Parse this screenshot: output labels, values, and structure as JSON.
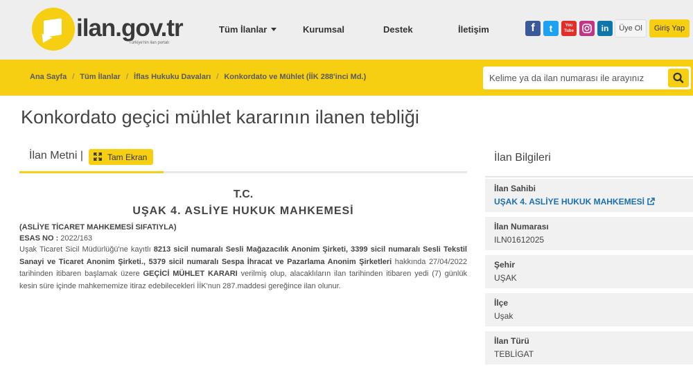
{
  "logo": {
    "text": "ilan.gov.tr",
    "tagline": "Türkiye'nin ilan portalı"
  },
  "nav": {
    "items": [
      {
        "label": "Tüm İlanlar"
      },
      {
        "label": "Kurumsal"
      },
      {
        "label": "Destek"
      },
      {
        "label": "İletişim"
      }
    ]
  },
  "social": {
    "facebook": "f",
    "twitter": "t",
    "youtube": "You Tube",
    "instagram": "ig",
    "linkedin": "in"
  },
  "auth": {
    "register_label": "Üye Ol",
    "login_label": "Giriş Yap"
  },
  "breadcrumb": {
    "items": [
      "Ana Sayfa",
      "Tüm İlanlar",
      "İflas Hukuku Davaları",
      "Konkordato ve Mühlet (İİK 288'inci Md.)"
    ]
  },
  "search": {
    "placeholder": "Kelime ya da ilan numarası ile arayınız"
  },
  "page": {
    "title": "Konkordato geçici mühlet kararının ilanen tebliği"
  },
  "tabs": {
    "active_label": "İlan Metni |",
    "fullscreen_label": "Tam Ekran"
  },
  "document": {
    "heading1": "T.C.",
    "heading2": "UŞAK 4. ASLİYE HUKUK MAHKEMESİ",
    "subheading": "(ASLİYE TİCARET MAHKEMESİ SIFATIYLA)",
    "esas_label": "ESAS NO :",
    "esas_value": " 2022/163",
    "body": [
      {
        "t": "Uşak Ticaret Sicil Müdürlüğü'ne kayıtlı ",
        "b": false
      },
      {
        "t": "8213 sicil numaralı Sesli Mağazacılık Anonim Şirketi, 3399 sicil numaralı Sesli Tekstil Sanayi ve Ticaret Anonim Şirketi., 5379 sicil numaralı Sespa İhracat ve Pazarlama Anonim Şirketleri",
        "b": true
      },
      {
        "t": " hakkında 27/04/2022 tarihinden itibaren başlamak üzere ",
        "b": false
      },
      {
        "t": "GEÇİCİ MÜHLET KARARI",
        "b": true
      },
      {
        "t": " verilmiş olup, alacaklıların ilan tarihinden itibaren yedi (7) günlük kesin süre içinde mahkememize itiraz edebilecekleri İİK'nun 287.maddesi gereğince ilan olunur.",
        "b": false
      }
    ]
  },
  "info_panel": {
    "title": "İlan Bilgileri",
    "fields": [
      {
        "label": "İlan Sahibi",
        "value": "UŞAK 4. ASLİYE HUKUK MAHKEMESİ",
        "link": true
      },
      {
        "label": "İlan Numarası",
        "value": "ILN01612025",
        "link": false
      },
      {
        "label": "Şehir",
        "value": "UŞAK",
        "link": false
      },
      {
        "label": "İlçe",
        "value": "Uşak",
        "link": false
      },
      {
        "label": "İlan Türü",
        "value": "TEBLİGAT",
        "link": false
      }
    ]
  },
  "colors": {
    "brand_yellow": "#f6cf12",
    "link_blue": "#1a6fb5",
    "facebook": "#3b5998",
    "twitter": "#1da1f2",
    "youtube": "#e52d27",
    "instagram": "#c13584",
    "linkedin": "#0e76a8"
  }
}
